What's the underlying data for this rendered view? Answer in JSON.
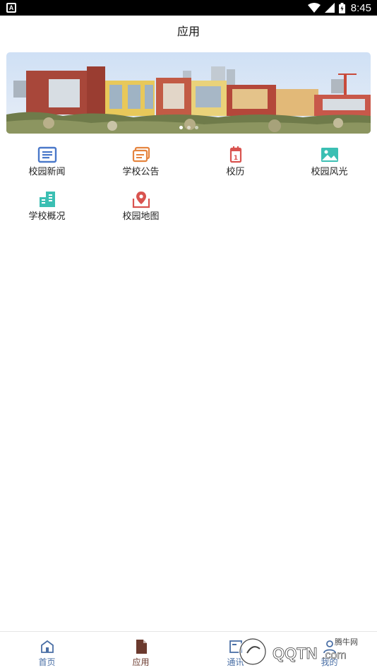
{
  "status_bar": {
    "time": "8:45",
    "notification_icon": "android-notification-icon",
    "icons": [
      "wifi-icon",
      "cell-signal-icon",
      "battery-icon"
    ]
  },
  "page": {
    "title": "应用"
  },
  "banner": {
    "slides": 3,
    "active_slide": 1
  },
  "apps": [
    {
      "label": "校园新闻",
      "icon": "news-icon",
      "color": "#4a78c9"
    },
    {
      "label": "学校公告",
      "icon": "announcement-icon",
      "color": "#e5843f"
    },
    {
      "label": "校历",
      "icon": "calendar-icon",
      "color": "#d9534f"
    },
    {
      "label": "校园风光",
      "icon": "landscape-icon",
      "color": "#3bbfb3"
    },
    {
      "label": "学校概况",
      "icon": "building-icon",
      "color": "#3bbfb3"
    },
    {
      "label": "校园地图",
      "icon": "map-pin-icon",
      "color": "#d9534f"
    }
  ],
  "tabbar": {
    "items": [
      {
        "label": "首页",
        "icon": "home-icon",
        "active": false
      },
      {
        "label": "应用",
        "icon": "document-icon",
        "active": true
      },
      {
        "label": "通讯",
        "icon": "contacts-icon",
        "active": false
      },
      {
        "label": "我的",
        "icon": "profile-icon",
        "active": false
      }
    ],
    "active_color": "#6b3a2e",
    "inactive_color": "#4a6fa5"
  },
  "watermark": {
    "text_top": "腾牛网",
    "text_main": "QQTN.com"
  }
}
